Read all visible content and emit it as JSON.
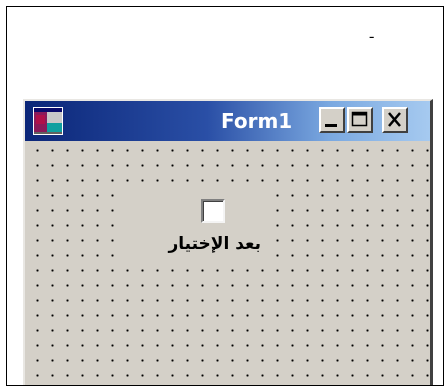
{
  "page": {
    "stray_mark": "-"
  },
  "window": {
    "title": "Form1",
    "icon": "app-window-icon",
    "buttons": {
      "minimize_icon": "minimize-icon",
      "maximize_icon": "maximize-icon",
      "close_icon": "close-icon"
    },
    "colors": {
      "titlebar_start": "#0b2678",
      "titlebar_end": "#a6caf0",
      "face": "#d4d0c8"
    }
  },
  "form": {
    "checkbox": {
      "label": "بعد الإختيار",
      "checked": false
    }
  }
}
